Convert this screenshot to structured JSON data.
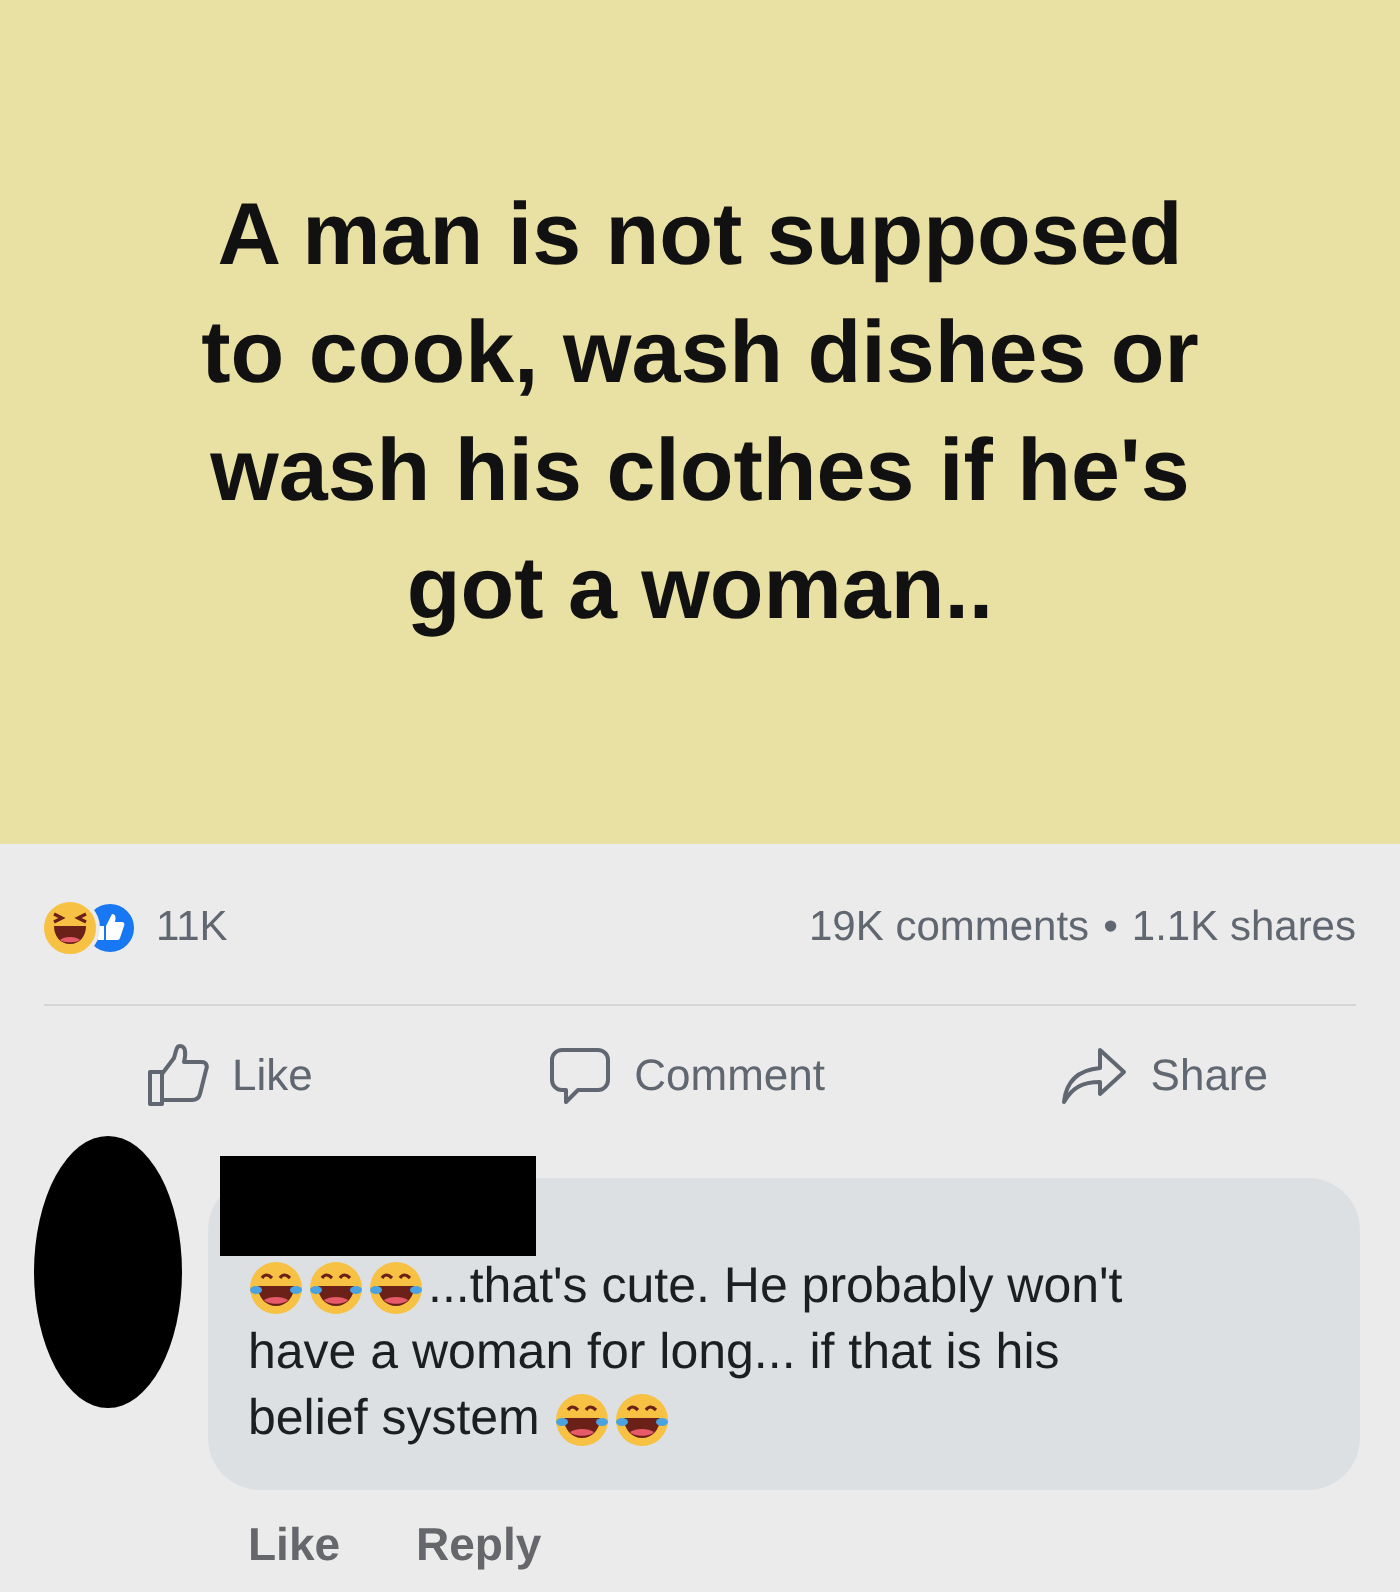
{
  "post_image": {
    "headline_lines": [
      "A man is not supposed",
      "to cook, wash dishes or",
      "wash his clothes if he's",
      "got a woman.."
    ]
  },
  "reactions": {
    "count": "11K",
    "comments": "19K comments",
    "separator": "•",
    "shares": "1.1K shares"
  },
  "actions": [
    {
      "kind": "like",
      "label": "Like"
    },
    {
      "kind": "comment",
      "label": "Comment"
    },
    {
      "kind": "share",
      "label": "Share"
    }
  ],
  "comment": {
    "lines": [
      [
        {
          "kind": "emoji"
        },
        {
          "kind": "emoji"
        },
        {
          "kind": "emoji"
        },
        {
          "kind": "text",
          "text": "...that's cute. He probably won't"
        }
      ],
      [
        {
          "kind": "text",
          "text": "have a woman for long... if that is his"
        }
      ],
      [
        {
          "kind": "text",
          "text": "belief system "
        },
        {
          "kind": "emoji"
        },
        {
          "kind": "emoji"
        }
      ]
    ],
    "actions": [
      "Like",
      "Reply"
    ]
  }
}
